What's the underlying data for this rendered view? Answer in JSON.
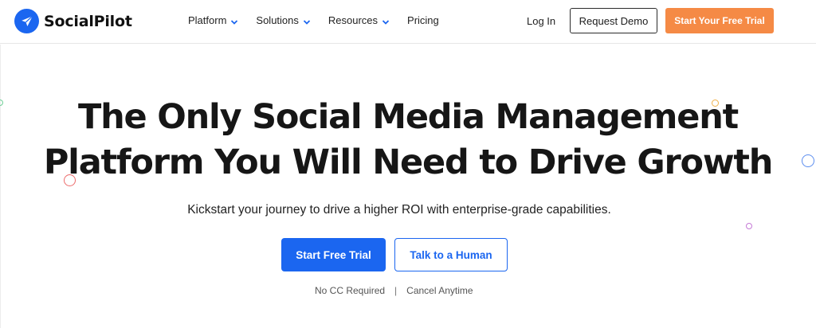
{
  "brand": {
    "name": "SocialPilot",
    "logo_icon": "paper-plane-icon",
    "color": "#1b66f0"
  },
  "nav": {
    "items": [
      {
        "label": "Platform",
        "has_dropdown": true
      },
      {
        "label": "Solutions",
        "has_dropdown": true
      },
      {
        "label": "Resources",
        "has_dropdown": true
      },
      {
        "label": "Pricing",
        "has_dropdown": false
      }
    ],
    "login": "Log In",
    "request_demo": "Request Demo",
    "start_trial": "Start Your Free Trial",
    "trial_color": "#f58a45"
  },
  "hero": {
    "title_line1": "The Only Social Media Management",
    "title_line2": "Platform You Will Need to Drive Growth",
    "subtitle": "Kickstart your journey to drive a higher ROI with enterprise-grade capabilities.",
    "cta_primary": "Start Free Trial",
    "cta_secondary": "Talk to a Human",
    "note_1": "No CC Required",
    "note_separator": "|",
    "note_2": "Cancel Anytime"
  }
}
